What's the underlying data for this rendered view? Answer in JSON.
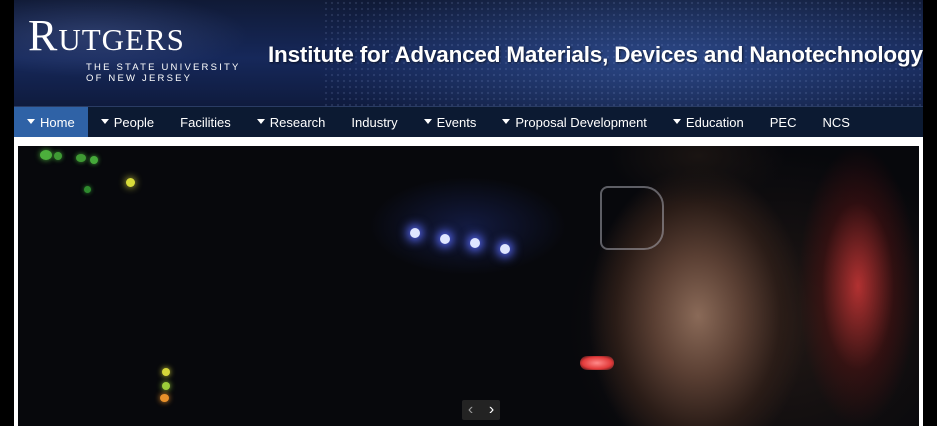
{
  "header": {
    "logo_word": "Rutgers",
    "logo_subtitle_line1": "THE STATE UNIVERSITY",
    "logo_subtitle_line2": "OF NEW JERSEY",
    "site_title": "Institute for Advanced Materials, Devices and Nanotechnology"
  },
  "nav": {
    "items": [
      {
        "label": "Home",
        "dropdown": true,
        "active": true
      },
      {
        "label": "People",
        "dropdown": true
      },
      {
        "label": "Facilities",
        "dropdown": false
      },
      {
        "label": "Research",
        "dropdown": true
      },
      {
        "label": "Industry",
        "dropdown": false
      },
      {
        "label": "Events",
        "dropdown": true
      },
      {
        "label": "Proposal Development",
        "dropdown": true
      },
      {
        "label": "Education",
        "dropdown": true
      },
      {
        "label": "PEC",
        "dropdown": false
      },
      {
        "label": "NCS",
        "dropdown": false
      }
    ]
  },
  "slider": {
    "prev_icon": "chevron-left-icon",
    "next_icon": "chevron-right-icon",
    "prev_glyph": "‹",
    "next_glyph": "›"
  },
  "colors": {
    "nav_bg": "#0c1a32",
    "nav_active": "#2f62a6",
    "header_bg": "#16285a"
  }
}
